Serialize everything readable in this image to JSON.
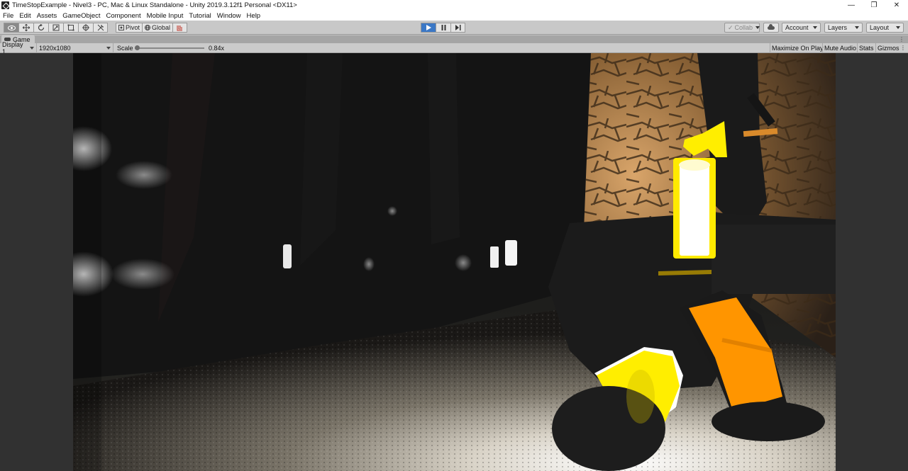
{
  "window": {
    "title": "TimeStopExample - Nivel3 - PC, Mac & Linux Standalone - Unity 2019.3.12f1 Personal <DX11>",
    "controls": [
      "—",
      "❐",
      "✕"
    ]
  },
  "menu": {
    "items": [
      "File",
      "Edit",
      "Assets",
      "GameObject",
      "Component",
      "Mobile Input",
      "Tutorial",
      "Window",
      "Help"
    ]
  },
  "toolbar": {
    "pivot_label": "Pivot",
    "global_label": "Global",
    "collab_label": "Collab",
    "account_label": "Account",
    "layers_label": "Layers",
    "layout_label": "Layout"
  },
  "game_tab": {
    "label": "Game",
    "menu_glyph": "⋮"
  },
  "game_controls": {
    "display": "Display 1",
    "resolution": "1920x1080",
    "scale_label": "Scale",
    "scale_value": "0.84x",
    "maximize": "Maximize On Play",
    "mute": "Mute Audio",
    "stats": "Stats",
    "gizmos": "Gizmos",
    "more_glyph": "⋮"
  },
  "colors": {
    "play_active": "#3b78c6",
    "toolbar_bg": "#c8c8c8",
    "viewport_bg": "#313131",
    "gun_yellow": "#ffee00",
    "gun_orange": "#ff9500"
  }
}
